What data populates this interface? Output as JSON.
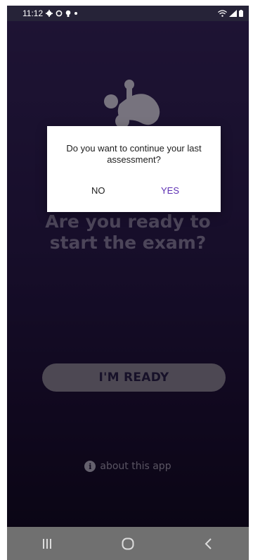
{
  "status_bar": {
    "time": "11:12",
    "icons": [
      "gear-icon",
      "ring-icon",
      "bulb-icon",
      "dot-icon",
      "wifi-icon",
      "signal-icon",
      "battery-icon"
    ]
  },
  "screen": {
    "headline_line1": "Are you ready to",
    "headline_line2": "start the exam?",
    "ready_button": "I'M READY",
    "about_link": "about this app"
  },
  "dialog": {
    "message": "Do you want to continue your last assessment?",
    "negative": "NO",
    "positive": "YES"
  },
  "navbar": {
    "icons": [
      "recent-apps-icon",
      "home-icon",
      "back-icon"
    ]
  },
  "colors": {
    "background_top": "#37245f",
    "background_bottom": "#140a27",
    "accent": "#5d2fb3",
    "button": "#8c8498"
  }
}
